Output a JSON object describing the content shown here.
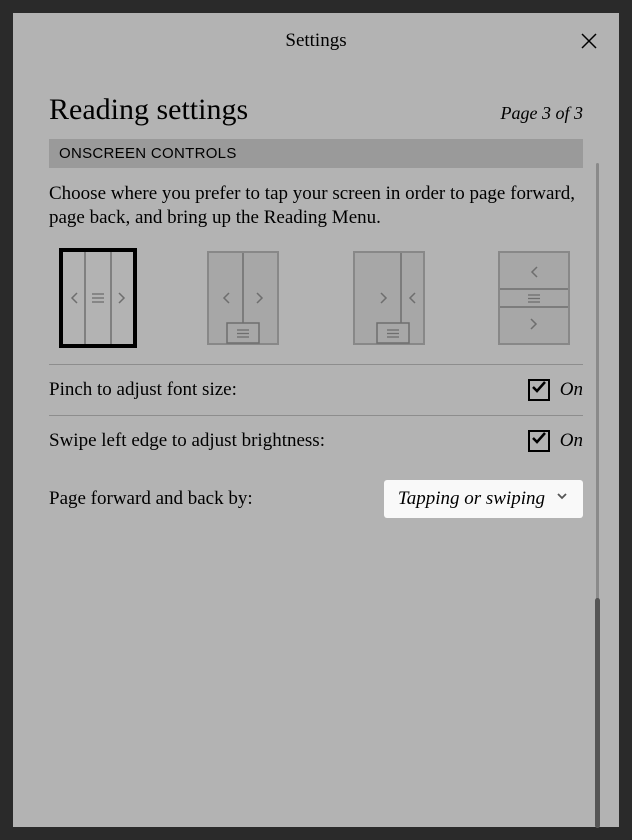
{
  "header": {
    "title": "Settings"
  },
  "page": {
    "title": "Reading settings",
    "indicator": "Page 3 of 3"
  },
  "section": {
    "header": "ONSCREEN CONTROLS"
  },
  "description": "Choose where you prefer to tap your screen in order to page forward, page back, and bring up the Reading Menu.",
  "settings": {
    "pinch": {
      "label": "Pinch to adjust font size:",
      "state": "On"
    },
    "swipe": {
      "label": "Swipe left edge to adjust brightness:",
      "state": "On"
    },
    "pagefwd": {
      "label": "Page forward and back by:",
      "selected": "Tapping or swiping"
    }
  }
}
